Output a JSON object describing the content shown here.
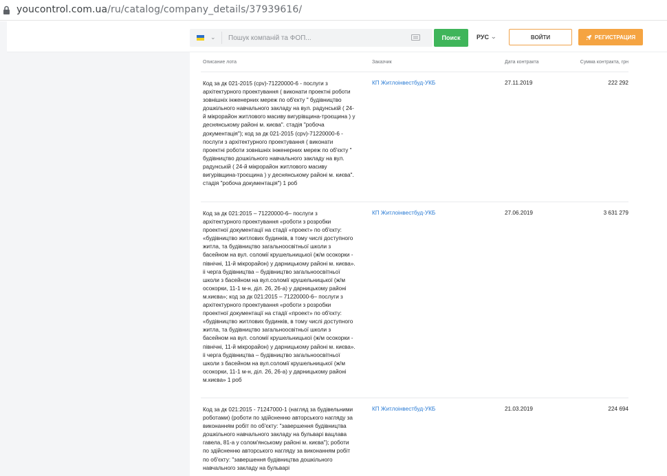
{
  "browser": {
    "url_host": "youcontrol.com.ua",
    "url_path": "/ru/catalog/company_details/37939616/"
  },
  "header": {
    "search_placeholder": "Пошук компаній та ФОП...",
    "search_button": "Поиск",
    "lang": "РУС",
    "login_button": "ВОЙТИ",
    "register_button": "РЕГИСТРАЦИЯ",
    "flag_colors": [
      "#2c6fc8",
      "#f3d020"
    ]
  },
  "table": {
    "columns": {
      "description": "Описание лота",
      "customer": "Заказчик",
      "date": "Дата контракта",
      "sum": "Сумма контракта, грн"
    },
    "rows": [
      {
        "description": "Код за дк 021-2015 (cpv)-71220000-6 - послуги з архітектурного проектування ( виконати проектні роботи зовнішніх інженерних мереж по об'єкту \" будівництво дошкільного навчального закладу на вул. радунській ( 24-й мікрорайон житлового масиву вигурівщина-троєщина ) у деснянському районі м. києва\". стадія \"робоча документація\"); код за дк 021-2015 (cpv)-71220000-6 - послуги з архітектурного проектування ( виконати проектні роботи зовнішніх інженерних мереж по об'єкту \" будівництво дошкільного навчального закладу на вул. радунській ( 24-й мікрорайон житлового масиву вигурівщина-троєщина ) у деснянському районі м. києва\". стадія \"робоча документація\") 1 роб",
        "customer": "КП Житлоінвестбуд-УКБ",
        "date": "27.11.2019",
        "sum": "222 292"
      },
      {
        "description": "Код за дк 021:2015 – 71220000-6– послуги з архітектурного проектування «роботи з розробки проектної документації на стадії «проект» по об'єкту: «будівництво житлових будинків, в тому числі доступного житла, та будівництво загальноосвітньої школи з басейном на вул. соломії крушельницької (ж/м осокорки - північні, 11-й мікрорайон) у дарницькому районі м. києва». ii черга будівництва – будівництво загальноосвітньої школи з басейном на вул.соломії крушельницької (ж/м осокорки, 11-1 м-н, діл. 26, 26-а) у дарницькому районі м.києва»; код за дк 021:2015 – 71220000-6– послуги з архітектурного проектування «роботи з розробки проектної документації на стадії «проект» по об'єкту: «будівництво житлових будинків, в тому числі доступного житла, та будівництво загальноосвітньої школи з басейном на вул. соломії крушельницької (ж/м осокорки - північні, 11-й мікрорайон) у дарницькому районі м. києва». ii черга будівництва – будівництво загальноосвітньої школи з басейном на вул.соломії крушельницької (ж/м осокорки, 11-1 м-н, діл. 26, 26-а) у дарницькому районі м.києва» 1 роб",
        "customer": "КП Житлоінвестбуд-УКБ",
        "date": "27.06.2019",
        "sum": "3 631 279"
      },
      {
        "description": "Код за дк 021:2015 - 71247000-1 (нагляд за будівельними роботами) (роботи по здійсненню авторського нагляду за виконанням робіт по об'єкту: \"завершення будівництва дошкільного навчального закладу на бульварі вацлава гавела, 81-а у солом'янському районі м. києва\"); роботи по здійсненню авторського нагляду за виконанням робіт по об'єкту: \"завершення будівництва дошкільного навчального закладу на бульварі",
        "customer": "КП Житлоінвестбуд-УКБ",
        "date": "21.03.2019",
        "sum": "224 694"
      }
    ]
  }
}
